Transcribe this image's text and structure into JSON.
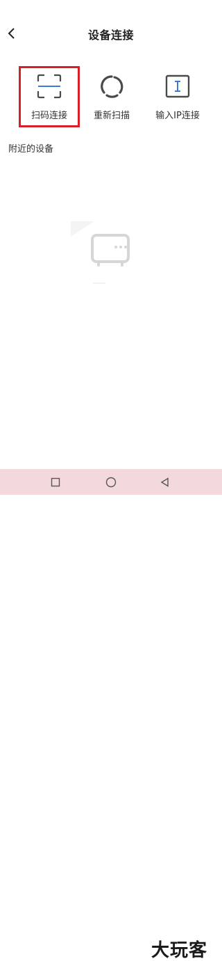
{
  "header": {
    "title": "设备连接",
    "back_icon": "chevron-left-icon"
  },
  "actions": [
    {
      "label": "扫码连接",
      "icon": "scan-frame-icon"
    },
    {
      "label": "重新扫描",
      "icon": "refresh-icon"
    },
    {
      "label": "输入IP连接",
      "icon": "text-input-icon"
    }
  ],
  "section": {
    "title": "附近的设备"
  },
  "empty_state": {
    "icon": "tv-icon"
  },
  "navbar": {
    "recents_icon": "square-icon",
    "home_icon": "circle-icon",
    "back_icon": "triangle-back-icon"
  },
  "watermark": {
    "text": "大玩客"
  },
  "colors": {
    "highlight": "#d81e28",
    "icon_gray": "#4a4a4a",
    "scan_line": "#3a7bd5",
    "empty_icon": "#d6d6d6",
    "navbar_bg": "#f3d9dc"
  }
}
